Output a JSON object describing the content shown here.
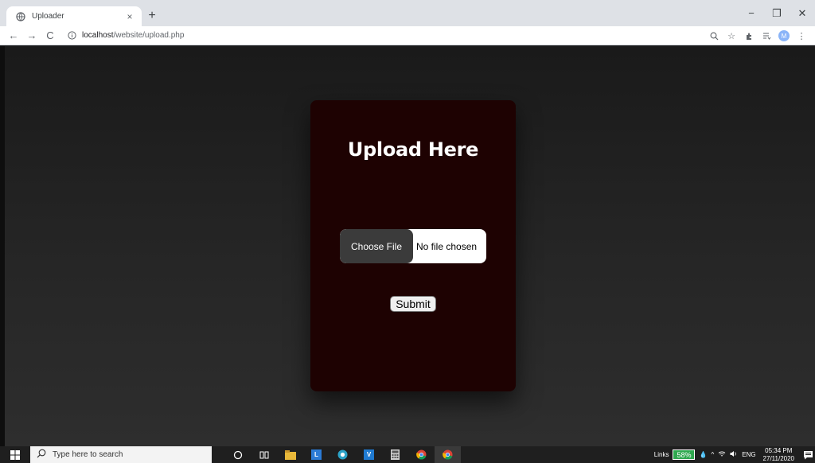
{
  "browser": {
    "tab_title": "Uploader",
    "tab_close": "×",
    "new_tab": "+",
    "window_controls": {
      "minimize": "−",
      "restore": "❐",
      "close": "✕"
    },
    "toolbar": {
      "back": "←",
      "forward": "→",
      "reload": "C",
      "url_host": "localhost",
      "url_path": "/website/upload.php",
      "profile_initial": "M"
    },
    "icons": [
      "zoom-icon",
      "star-icon",
      "extensions-icon",
      "reading-list-icon",
      "profile-avatar",
      "menu-icon"
    ]
  },
  "page": {
    "heading": "Upload Here",
    "file_input": {
      "button_label": "Choose File",
      "status": "No file chosen"
    },
    "submit_label": "Submit",
    "colors": {
      "card_bg": "#1e0202",
      "page_bg": "#202124",
      "choose_btn": "#3b3b3b"
    }
  },
  "taskbar": {
    "search_placeholder": "Type here to search",
    "apps": [
      "cortana-icon",
      "task-view-icon",
      "file-explorer-icon",
      "l-app-icon",
      "browser-icon",
      "vs-code-icon",
      "calculator-icon",
      "chrome-icon",
      "chrome-active-icon"
    ],
    "tray": {
      "links_label": "Links",
      "battery": "58%",
      "language": "ENG",
      "time": "05:34 PM",
      "date": "27/11/2020"
    }
  }
}
